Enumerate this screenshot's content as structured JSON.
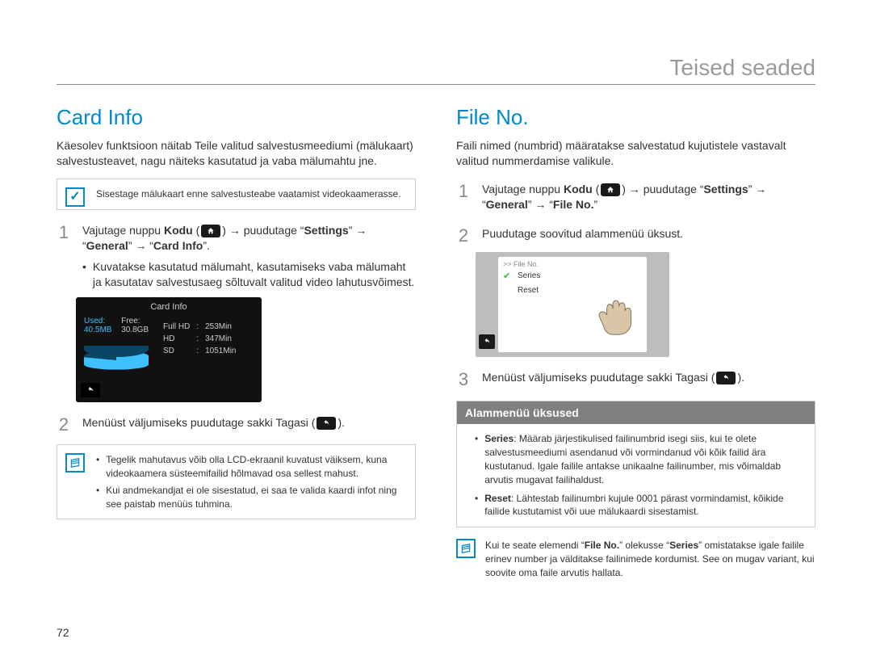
{
  "header": {
    "title": "Teised seaded"
  },
  "page_number": "72",
  "arrows": {
    "right": "→"
  },
  "left": {
    "section_title": "Card Info",
    "intro": "Käesolev funktsioon näitab Teile valitud salvestusmeediumi (mälukaart) salvestusteavet, nagu näiteks kasutatud ja vaba mälumahtu jne.",
    "note1": "Sisestage mälukaart enne salvestusteabe vaatamist videokaamerasse.",
    "step1": {
      "num": "1",
      "prefix": "Vajutage nuppu ",
      "kodu": "Kodu",
      "mid": " → puudutage “",
      "settings": "Settings",
      "mid2": "” → “",
      "general": "General",
      "mid3": "” → “",
      "target": "Card Info",
      "suffix": "”.",
      "bullet": "Kuvatakse kasutatud mälumaht, kasutamiseks vaba mälumaht ja kasutatav salvestusaeg sõltuvalt valitud video lahutusvõimest."
    },
    "lcd": {
      "title": "Card Info",
      "used_label": "Used:",
      "used_val": "40.5MB",
      "free_label": "Free:",
      "free_val": "30.8GB",
      "rows": [
        {
          "k": "Full HD",
          "v": "253Min"
        },
        {
          "k": "HD",
          "v": "347Min"
        },
        {
          "k": "SD",
          "v": "1051Min"
        }
      ]
    },
    "step2": {
      "num": "2",
      "text_a": "Menüüst väljumiseks puudutage sakki Tagasi (",
      "text_b": ")."
    },
    "note2": {
      "items": [
        "Tegelik mahutavus võib olla LCD-ekraanil kuvatust väiksem, kuna videokaamera süsteemifailid hõlmavad osa sellest mahust.",
        "Kui andmekandjat ei ole sisestatud, ei saa te valida kaardi infot ning see paistab menüüs tuhmina."
      ]
    }
  },
  "right": {
    "section_title": "File No.",
    "intro": "Faili nimed (numbrid) määratakse salvestatud kujutistele vastavalt valitud nummerdamise valikule.",
    "step1": {
      "num": "1",
      "prefix": "Vajutage nuppu ",
      "kodu": "Kodu",
      "mid": " → puudutage “",
      "settings": "Settings",
      "mid2": "” → “",
      "general": "General",
      "mid3": "” → “",
      "target": "File No.",
      "suffix": "”"
    },
    "step2": {
      "num": "2",
      "text": "Puudutage soovitud alammenüü üksust."
    },
    "lcd": {
      "breadcrumb": ">> File No.",
      "items": [
        "Series",
        "Reset"
      ]
    },
    "step3": {
      "num": "3",
      "text_a": "Menüüst väljumiseks puudutage sakki Tagasi (",
      "text_b": ")."
    },
    "submenu": {
      "header": "Alammenüü üksused",
      "items": [
        {
          "k": "Series",
          "v": ": Määrab järjestikulised failinumbrid isegi siis, kui te olete salvestusmeediumi asendanud või vormindanud või kõik failid ära kustutanud. Igale failile antakse unikaalne failinumber, mis võimaldab arvutis mugavat failihaldust."
        },
        {
          "k": "Reset",
          "v": ": Lähtestab failinumbri kujule 0001 pärast vormindamist, kõikide failide kustutamist või uue mälukaardi sisestamist."
        }
      ]
    },
    "note3_a": "Kui te seate elemendi “",
    "note3_b": "File No.",
    "note3_c": "” olekusse “",
    "note3_d": "Series",
    "note3_e": "” omistatakse igale failile erinev number ja välditakse failinimede kordumist. See on mugav variant, kui soovite oma faile arvutis hallata."
  }
}
